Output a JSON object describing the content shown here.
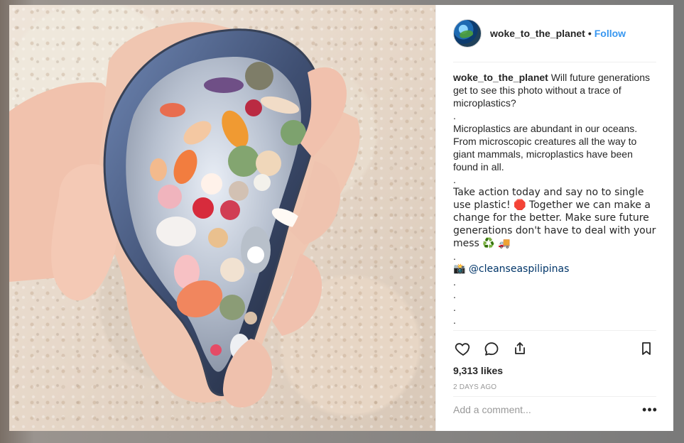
{
  "post": {
    "username": "woke_to_the_planet",
    "separator": "•",
    "follow_label": "Follow",
    "caption_lines": [
      "Will future generations get to see this photo without a trace of microplastics?",
      ".",
      "Microplastics are abundant in our oceans. From microscopic creatures all the way to giant mammals, microplastics have been found in all.",
      ".",
      "Take action today and say no to single use plastic! 🛑 Together we can make a change for the better. Make sure future generations don't have to deal with your mess ♻️ 🚚",
      ".",
      "📸 @cleanseaspilipinas",
      ".",
      ".",
      ".",
      ".",
      "."
    ],
    "caption_tag": "@cleanseaspilipinas",
    "likes": "9,313 likes",
    "time": "2 DAYS AGO",
    "comment_placeholder": "Add a comment...",
    "more_label": "•••"
  }
}
